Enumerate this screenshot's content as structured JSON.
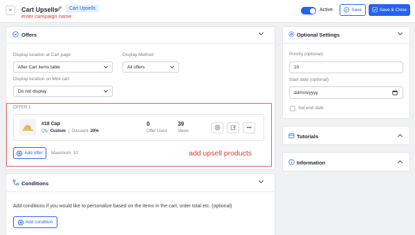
{
  "header": {
    "title": "Cart Upsells",
    "badge": "Cart Upsells",
    "annotation": "enter campaign name",
    "toggle_label": "Active",
    "save_label": "Save",
    "save_close_label": "Save & Close"
  },
  "offers": {
    "section_title": "Offers",
    "display_location_label": "Display location at Cart page",
    "display_location_value": "After Cart items table",
    "display_method_label": "Display Method",
    "display_method_value": "All offers",
    "mini_cart_label": "Display location on Mini-cart",
    "mini_cart_value": "Do not display",
    "offer_label": "OFFER 1",
    "product_name": "#18 Cap",
    "qty_prefix": "Qty:",
    "qty_value": "Custom",
    "separator": "|",
    "discount_prefix": "Discount:",
    "discount_value": "20%",
    "offer_used_value": "0",
    "offer_used_label": "Offer Used",
    "views_value": "39",
    "views_label": "Views",
    "add_offer_label": "Add offer",
    "maximum_label": "Maximum: 10",
    "annotation": "add upsell products"
  },
  "conditions": {
    "section_title": "Conditions",
    "description": "Add conditions if you would like to personalize based on the items in the cart, order total etc. (optional)",
    "add_condition_label": "Add condition"
  },
  "optional_settings": {
    "section_title": "Optional Settings",
    "priority_label": "Priority (optional)",
    "priority_value": "10",
    "start_date_label": "Start date (optional)",
    "start_date_placeholder": "dd/mm/yyyy",
    "set_end_date_label": "Set end date"
  },
  "tutorials": {
    "section_title": "Tutorials"
  },
  "information": {
    "section_title": "Information"
  },
  "colors": {
    "primary": "#2563eb",
    "annotation_red": "#d93a3a",
    "badge_bg": "#e7efff",
    "page_bg": "#f0f1f3"
  },
  "icons": [
    "close-icon",
    "edit-pencil-icon",
    "toggle-switch",
    "check-circle-icon",
    "save-icon",
    "offers-icon",
    "conditions-icon",
    "settings-icon",
    "tutorials-icon",
    "info-icon",
    "calendar-icon",
    "eye-icon",
    "edit-icon",
    "more-icon",
    "product-cap-image"
  ]
}
